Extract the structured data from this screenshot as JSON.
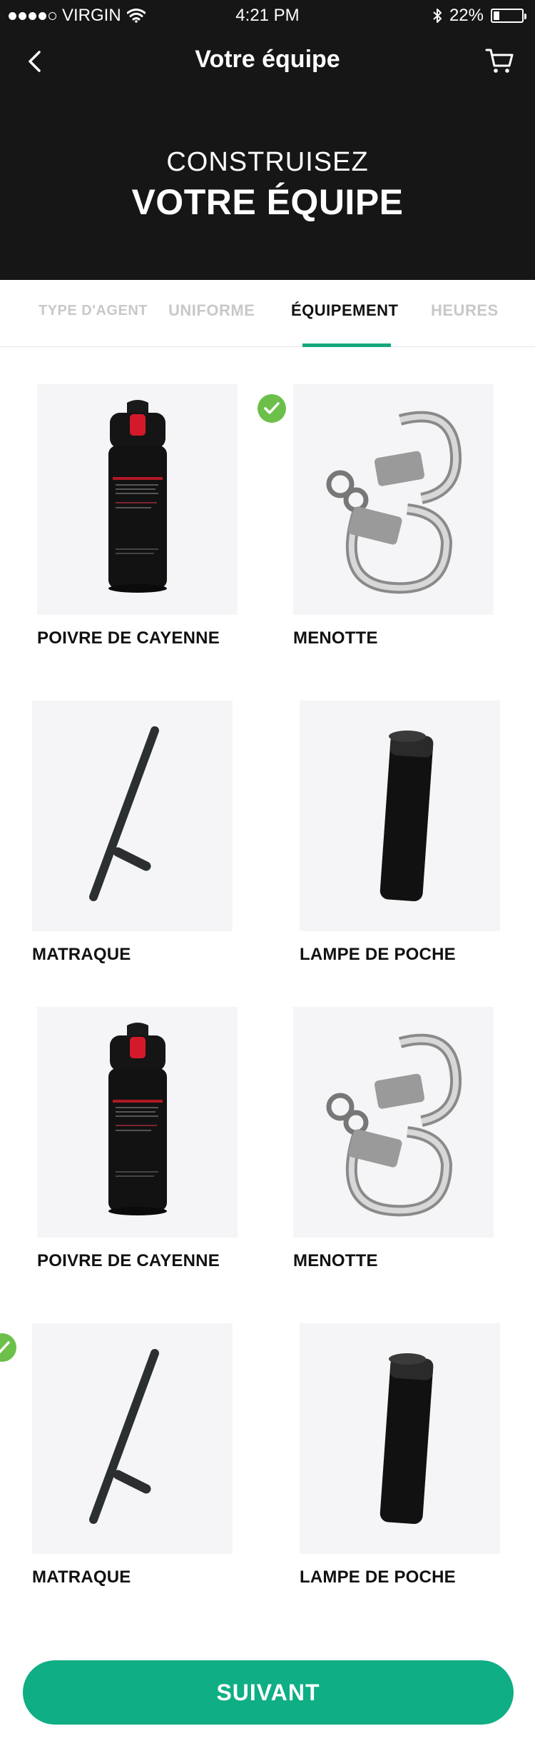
{
  "status_bar": {
    "carrier": "VIRGIN",
    "time": "4:21 PM",
    "battery": "22%",
    "battery_level": 0.22
  },
  "nav": {
    "title": "Votre équipe",
    "back_icon": "chevron-left-icon",
    "cart_icon": "cart-icon"
  },
  "hero": {
    "line1": "CONSTRUISEZ",
    "line2": "VOTRE ÉQUIPE"
  },
  "tabs": [
    {
      "label": "TYPE D'AGENT",
      "active": false
    },
    {
      "label": "UNIFORME",
      "active": false
    },
    {
      "label": "ÉQUIPEMENT",
      "active": true
    },
    {
      "label": "HEURES",
      "active": false
    }
  ],
  "items": [
    {
      "label": "POIVRE DE CAYENNE",
      "image": "pepper-spray",
      "selected": false
    },
    {
      "label": "MENOTTE",
      "image": "handcuffs",
      "selected": true
    },
    {
      "label": "MATRAQUE",
      "image": "baton",
      "selected": false
    },
    {
      "label": "LAMPE DE POCHE",
      "image": "flashlight",
      "selected": false
    },
    {
      "label": "POIVRE DE CAYENNE",
      "image": "pepper-spray",
      "selected": false
    },
    {
      "label": "MENOTTE",
      "image": "handcuffs",
      "selected": false
    },
    {
      "label": "MATRAQUE",
      "image": "baton",
      "selected": true
    },
    {
      "label": "LAMPE DE POCHE",
      "image": "flashlight",
      "selected": false
    }
  ],
  "cta": {
    "label": "SUIVANT"
  },
  "colors": {
    "header_bg": "#161616",
    "accent": "#0fae84",
    "check": "#6cc04a",
    "tab_inactive": "#c8c8c8"
  }
}
